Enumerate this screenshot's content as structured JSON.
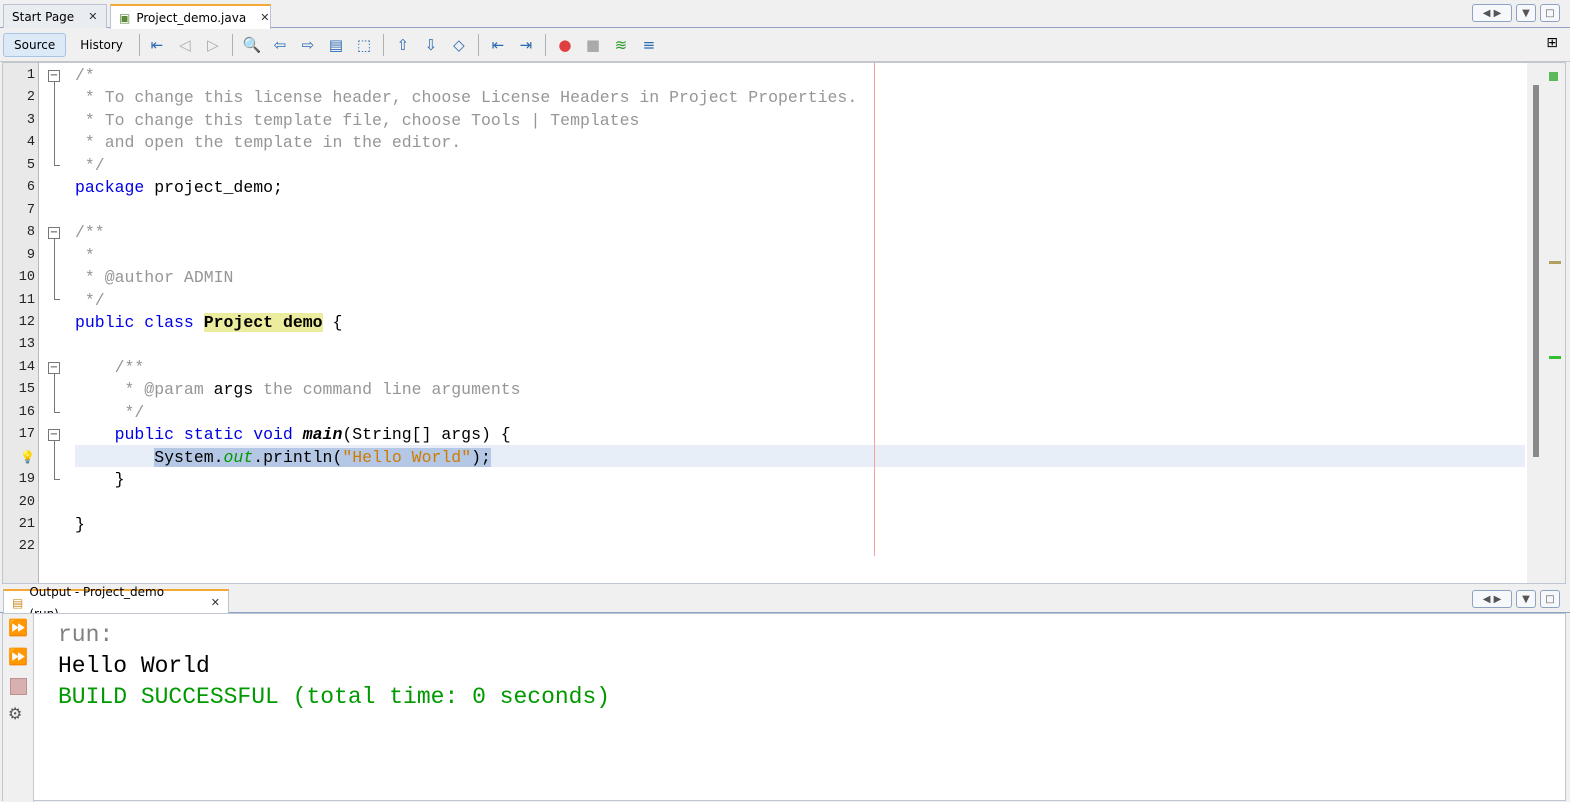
{
  "tabs": [
    {
      "label": "Start Page",
      "active": false
    },
    {
      "label": "Project_demo.java",
      "active": true
    }
  ],
  "toolbar": {
    "source": "Source",
    "history": "History",
    "icons": [
      "last-edit-icon",
      "back-icon",
      "forward-icon",
      "find-icon",
      "find-previous-icon",
      "find-next-icon",
      "toggle-highlight-icon",
      "rect-select-icon",
      "previous-bookmark-icon",
      "next-bookmark-icon",
      "toggle-bookmark-icon",
      "shift-left-icon",
      "shift-right-icon",
      "start-macro-icon",
      "stop-macro-icon",
      "comment-icon",
      "uncomment-icon"
    ]
  },
  "editor": {
    "lines": [
      [
        [
          "/*",
          "cmt"
        ]
      ],
      [
        [
          " * To change this license header, choose License Headers in Project Properties.",
          "cmt"
        ]
      ],
      [
        [
          " * To change this template file, choose Tools | Templates",
          "cmt"
        ]
      ],
      [
        [
          " * and open the template in the editor.",
          "cmt"
        ]
      ],
      [
        [
          " */",
          "cmt"
        ]
      ],
      [
        [
          "package",
          "kw"
        ],
        [
          " project_demo;",
          "pln"
        ]
      ],
      [],
      [
        [
          "/**",
          "cmt"
        ]
      ],
      [
        [
          " *",
          "cmt"
        ]
      ],
      [
        [
          " * @author ADMIN",
          "cmt"
        ]
      ],
      [
        [
          " */",
          "cmt"
        ]
      ],
      [
        [
          "public class",
          "kw"
        ],
        [
          " ",
          "pln"
        ],
        [
          "Project demo",
          "hlcls"
        ],
        [
          " {",
          "pln"
        ]
      ],
      [],
      [
        [
          "    /**",
          "cmt"
        ]
      ],
      [
        [
          "     * @param ",
          "cmt"
        ],
        [
          "args",
          "pln"
        ],
        [
          " the command line arguments",
          "cmt"
        ]
      ],
      [
        [
          "     */",
          "cmt"
        ]
      ],
      [
        [
          "    public static void",
          "kw"
        ],
        [
          " ",
          "pln"
        ],
        [
          "main",
          "mth"
        ],
        [
          "(String[] args) {",
          "pln"
        ]
      ],
      [
        [
          "        System.",
          "pln"
        ],
        [
          "out",
          "fld"
        ],
        [
          ".println(",
          "pln"
        ],
        [
          "\"Hello World\"",
          "str"
        ],
        [
          ");",
          "pln"
        ]
      ],
      [
        [
          "    }",
          "pln"
        ]
      ],
      [],
      [
        [
          "}",
          "pln"
        ]
      ],
      []
    ],
    "hint_line": 18
  },
  "output": {
    "tab_label": "Output - Project_demo (run)",
    "lines": [
      {
        "text": "run:",
        "color": "#808080"
      },
      {
        "text": "Hello World",
        "color": "#000000"
      },
      {
        "text": "BUILD SUCCESSFUL (total time: 0 seconds)",
        "color": "#009900"
      }
    ],
    "icons": [
      "rerun-icon",
      "rerun-with-options-icon",
      "stop-icon",
      "settings-icon"
    ]
  },
  "colors": {
    "accent": "#f4a836",
    "keyword": "#0000e6",
    "comment": "#969696",
    "string": "#ce7b00"
  }
}
